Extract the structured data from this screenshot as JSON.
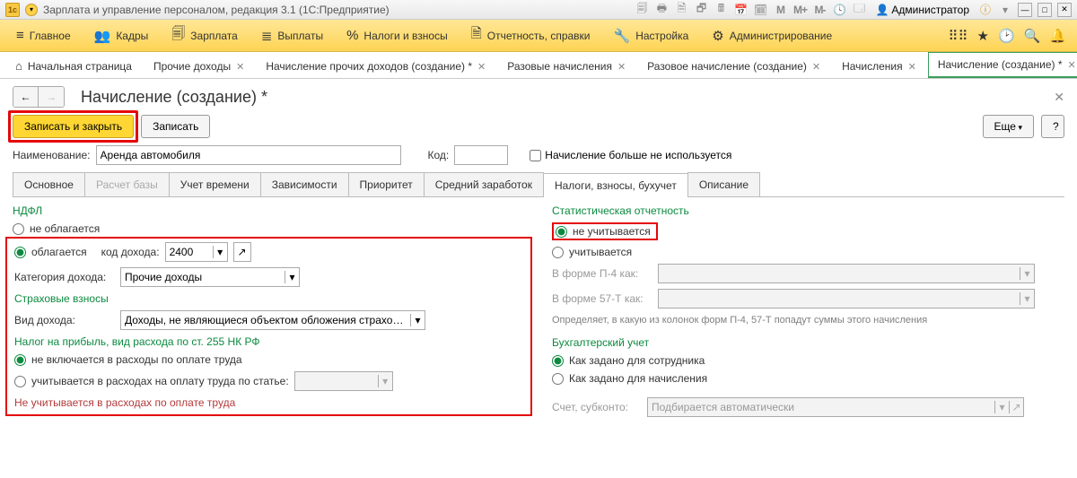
{
  "titlebar": {
    "app_title": "Зарплата и управление персоналом, редакция 3.1  (1С:Предприятие)",
    "admin_label": "Администратор",
    "m_icons": [
      "M",
      "M+",
      "M-"
    ]
  },
  "mainmenu": {
    "items": [
      {
        "icon": "≡",
        "label": "Главное"
      },
      {
        "icon": "👥",
        "label": "Кадры"
      },
      {
        "icon": "🗐",
        "label": "Зарплата"
      },
      {
        "icon": "≣",
        "label": "Выплаты"
      },
      {
        "icon": "%",
        "label": "Налоги и взносы"
      },
      {
        "icon": "🗎",
        "label": "Отчетность, справки"
      },
      {
        "icon": "🔧",
        "label": "Настройка"
      },
      {
        "icon": "⚙",
        "label": "Администрирование"
      }
    ]
  },
  "tabs": [
    {
      "label": "Начальная страница",
      "home": true
    },
    {
      "label": "Прочие доходы",
      "close": true
    },
    {
      "label": "Начисление прочих доходов (создание) *",
      "close": true
    },
    {
      "label": "Разовые начисления",
      "close": true
    },
    {
      "label": "Разовое начисление (создание)",
      "close": true
    },
    {
      "label": "Начисления",
      "close": true
    },
    {
      "label": "Начисление (создание) *",
      "close": true,
      "active": true
    }
  ],
  "page": {
    "title": "Начисление (создание) *",
    "save_close": "Записать и закрыть",
    "save": "Записать",
    "more": "Еще",
    "help": "?",
    "name_label": "Наименование:",
    "name_value": "Аренда автомобиля",
    "code_label": "Код:",
    "code_value": "",
    "not_used": "Начисление больше не используется"
  },
  "inner_tabs": [
    {
      "label": "Основное"
    },
    {
      "label": "Расчет базы",
      "disabled": true
    },
    {
      "label": "Учет времени"
    },
    {
      "label": "Зависимости"
    },
    {
      "label": "Приоритет"
    },
    {
      "label": "Средний заработок"
    },
    {
      "label": "Налоги, взносы, бухучет",
      "active": true,
      "hl": true
    },
    {
      "label": "Описание"
    }
  ],
  "left": {
    "ndfl_title": "НДФЛ",
    "ndfl_not_taxed": "не облагается",
    "ndfl_taxed": "облагается",
    "income_code_label": "код дохода:",
    "income_code": "2400",
    "income_cat_label": "Категория дохода:",
    "income_cat": "Прочие доходы",
    "insurance_title": "Страховые взносы",
    "income_type_label": "Вид дохода:",
    "income_type": "Доходы, не являющиеся объектом обложения страховыми в",
    "profit_title": "Налог на прибыль, вид расхода по ст. 255 НК РФ",
    "not_included": "не включается в расходы по оплате труда",
    "included": "учитывается в расходах на оплату труда по статье:",
    "not_accounted": "Не учитывается в расходах по оплате труда"
  },
  "right": {
    "stat_title": "Статистическая отчетность",
    "stat_not": "не учитывается",
    "stat_yes": "учитывается",
    "p4_label": "В форме П-4 как:",
    "p57_label": "В форме 57-Т как:",
    "hint": "Определяет, в какую из колонок форм П-4, 57-Т попадут суммы этого начисления",
    "buh_title": "Бухгалтерский учет",
    "buh_emp": "Как задано для сотрудника",
    "buh_calc": "Как задано для начисления",
    "account_label": "Счет, субконто:",
    "account_placeholder": "Подбирается автоматически"
  }
}
